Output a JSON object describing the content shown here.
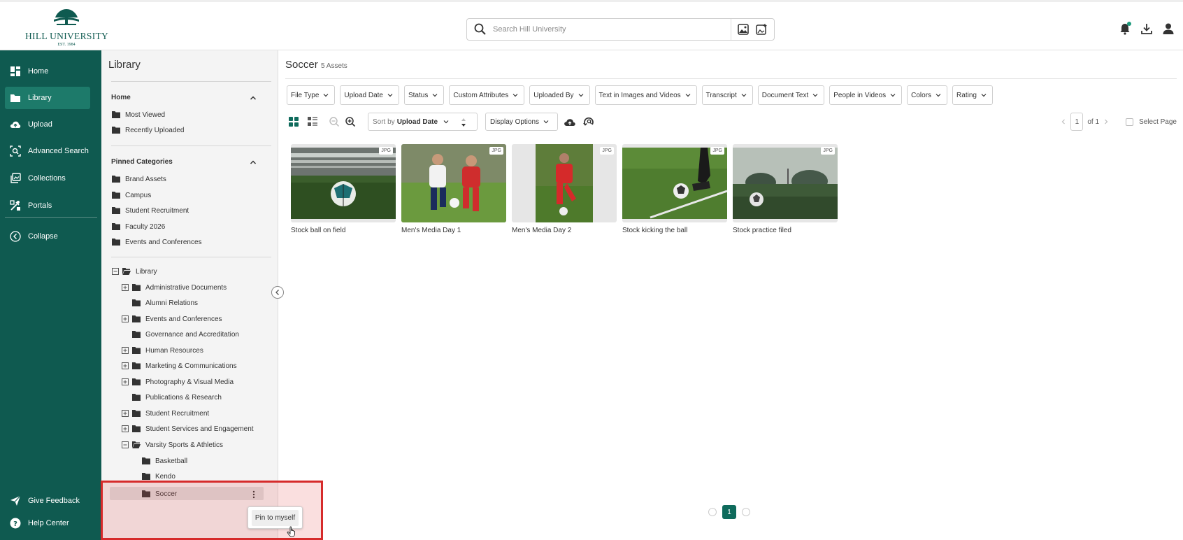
{
  "brand": {
    "name": "HILL UNIVERSITY",
    "est": "EST. 1984",
    "accent": "#0f5a50"
  },
  "search": {
    "placeholder": "Search Hill University"
  },
  "nav": {
    "items": [
      {
        "label": "Home",
        "icon": "dashboard-icon"
      },
      {
        "label": "Library",
        "icon": "folder-icon",
        "active": true
      },
      {
        "label": "Upload",
        "icon": "cloud-upload-icon"
      },
      {
        "label": "Advanced Search",
        "icon": "search-scan-icon"
      },
      {
        "label": "Collections",
        "icon": "collections-icon"
      },
      {
        "label": "Portals",
        "icon": "portals-icon"
      },
      {
        "label": "Collapse",
        "icon": "chevron-left-circle-icon"
      }
    ],
    "bottom": [
      {
        "label": "Give Feedback",
        "icon": "send-icon"
      },
      {
        "label": "Help Center",
        "icon": "help-circle-icon"
      }
    ]
  },
  "library_panel": {
    "title": "Library",
    "home_section": {
      "title": "Home",
      "items": [
        "Most Viewed",
        "Recently Uploaded"
      ]
    },
    "pinned_section": {
      "title": "Pinned Categories",
      "items": [
        "Brand Assets",
        "Campus",
        "Student Recruitment",
        "Faculty 2026",
        "Events and Conferences"
      ]
    },
    "tree": {
      "root": "Library",
      "folders": [
        {
          "label": "Administrative Documents",
          "expandable": true
        },
        {
          "label": "Alumni Relations",
          "expandable": false
        },
        {
          "label": "Events and Conferences",
          "expandable": true
        },
        {
          "label": "Governance and Accreditation",
          "expandable": false
        },
        {
          "label": "Human Resources",
          "expandable": true
        },
        {
          "label": "Marketing & Communications",
          "expandable": true
        },
        {
          "label": "Photography & Visual Media",
          "expandable": true
        },
        {
          "label": "Publications & Research",
          "expandable": false
        },
        {
          "label": "Student Recruitment",
          "expandable": true
        },
        {
          "label": "Student Services and Engagement",
          "expandable": true
        },
        {
          "label": "Varsity Sports & Athletics",
          "expandable": true,
          "expanded": true
        }
      ],
      "subfolders": [
        "Basketball",
        "Kendo",
        "Soccer"
      ],
      "selected": "Soccer"
    }
  },
  "main": {
    "title": "Soccer",
    "count": "5 Assets",
    "filters": [
      "File Type",
      "Upload Date",
      "Status",
      "Custom Attributes",
      "Uploaded By",
      "Text in Images and Videos",
      "Transcript",
      "Document Text",
      "People in Videos",
      "Colors",
      "Rating"
    ],
    "sort": {
      "prefix": "Sort by",
      "value": "Upload Date"
    },
    "display_options": "Display Options",
    "pager": {
      "page": "1",
      "of": "of 1",
      "select_page": "Select Page"
    },
    "assets": [
      {
        "title": "Stock ball on field",
        "type": "JPG"
      },
      {
        "title": "Men's Media Day 1",
        "type": "JPG"
      },
      {
        "title": "Men's Media Day 2",
        "type": "JPG"
      },
      {
        "title": "Stock kicking the ball",
        "type": "JPG"
      },
      {
        "title": "Stock practice filed",
        "type": "JPG"
      }
    ],
    "bottom_page": "1"
  },
  "context_menu": {
    "label": "Pin to myself"
  }
}
